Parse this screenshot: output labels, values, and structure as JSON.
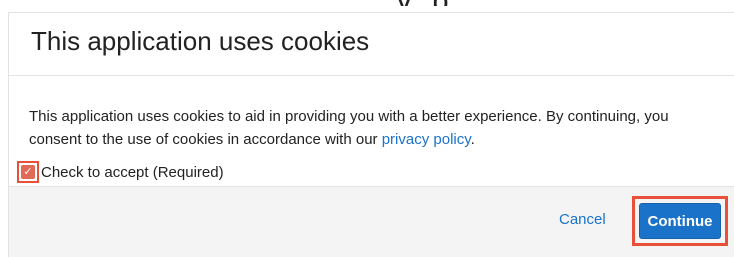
{
  "top_clip": {
    "text": "y  p"
  },
  "dialog": {
    "title": "This application uses cookies",
    "body_before_link": "This application uses cookies to aid in providing you with a better experience. By continuing, you consent to the use of cookies in accordance with our ",
    "link_text": "privacy policy",
    "body_after_link": ".",
    "checkbox_label": "Check to accept (Required)",
    "checkbox_checked": true,
    "checkbox_glyph": "✓",
    "cancel_label": "Cancel",
    "continue_label": "Continue"
  },
  "colors": {
    "link": "#1a73c9",
    "primary_button": "#1b72c9",
    "highlight": "#e8503a",
    "footer_bg": "#f4f4f4"
  }
}
